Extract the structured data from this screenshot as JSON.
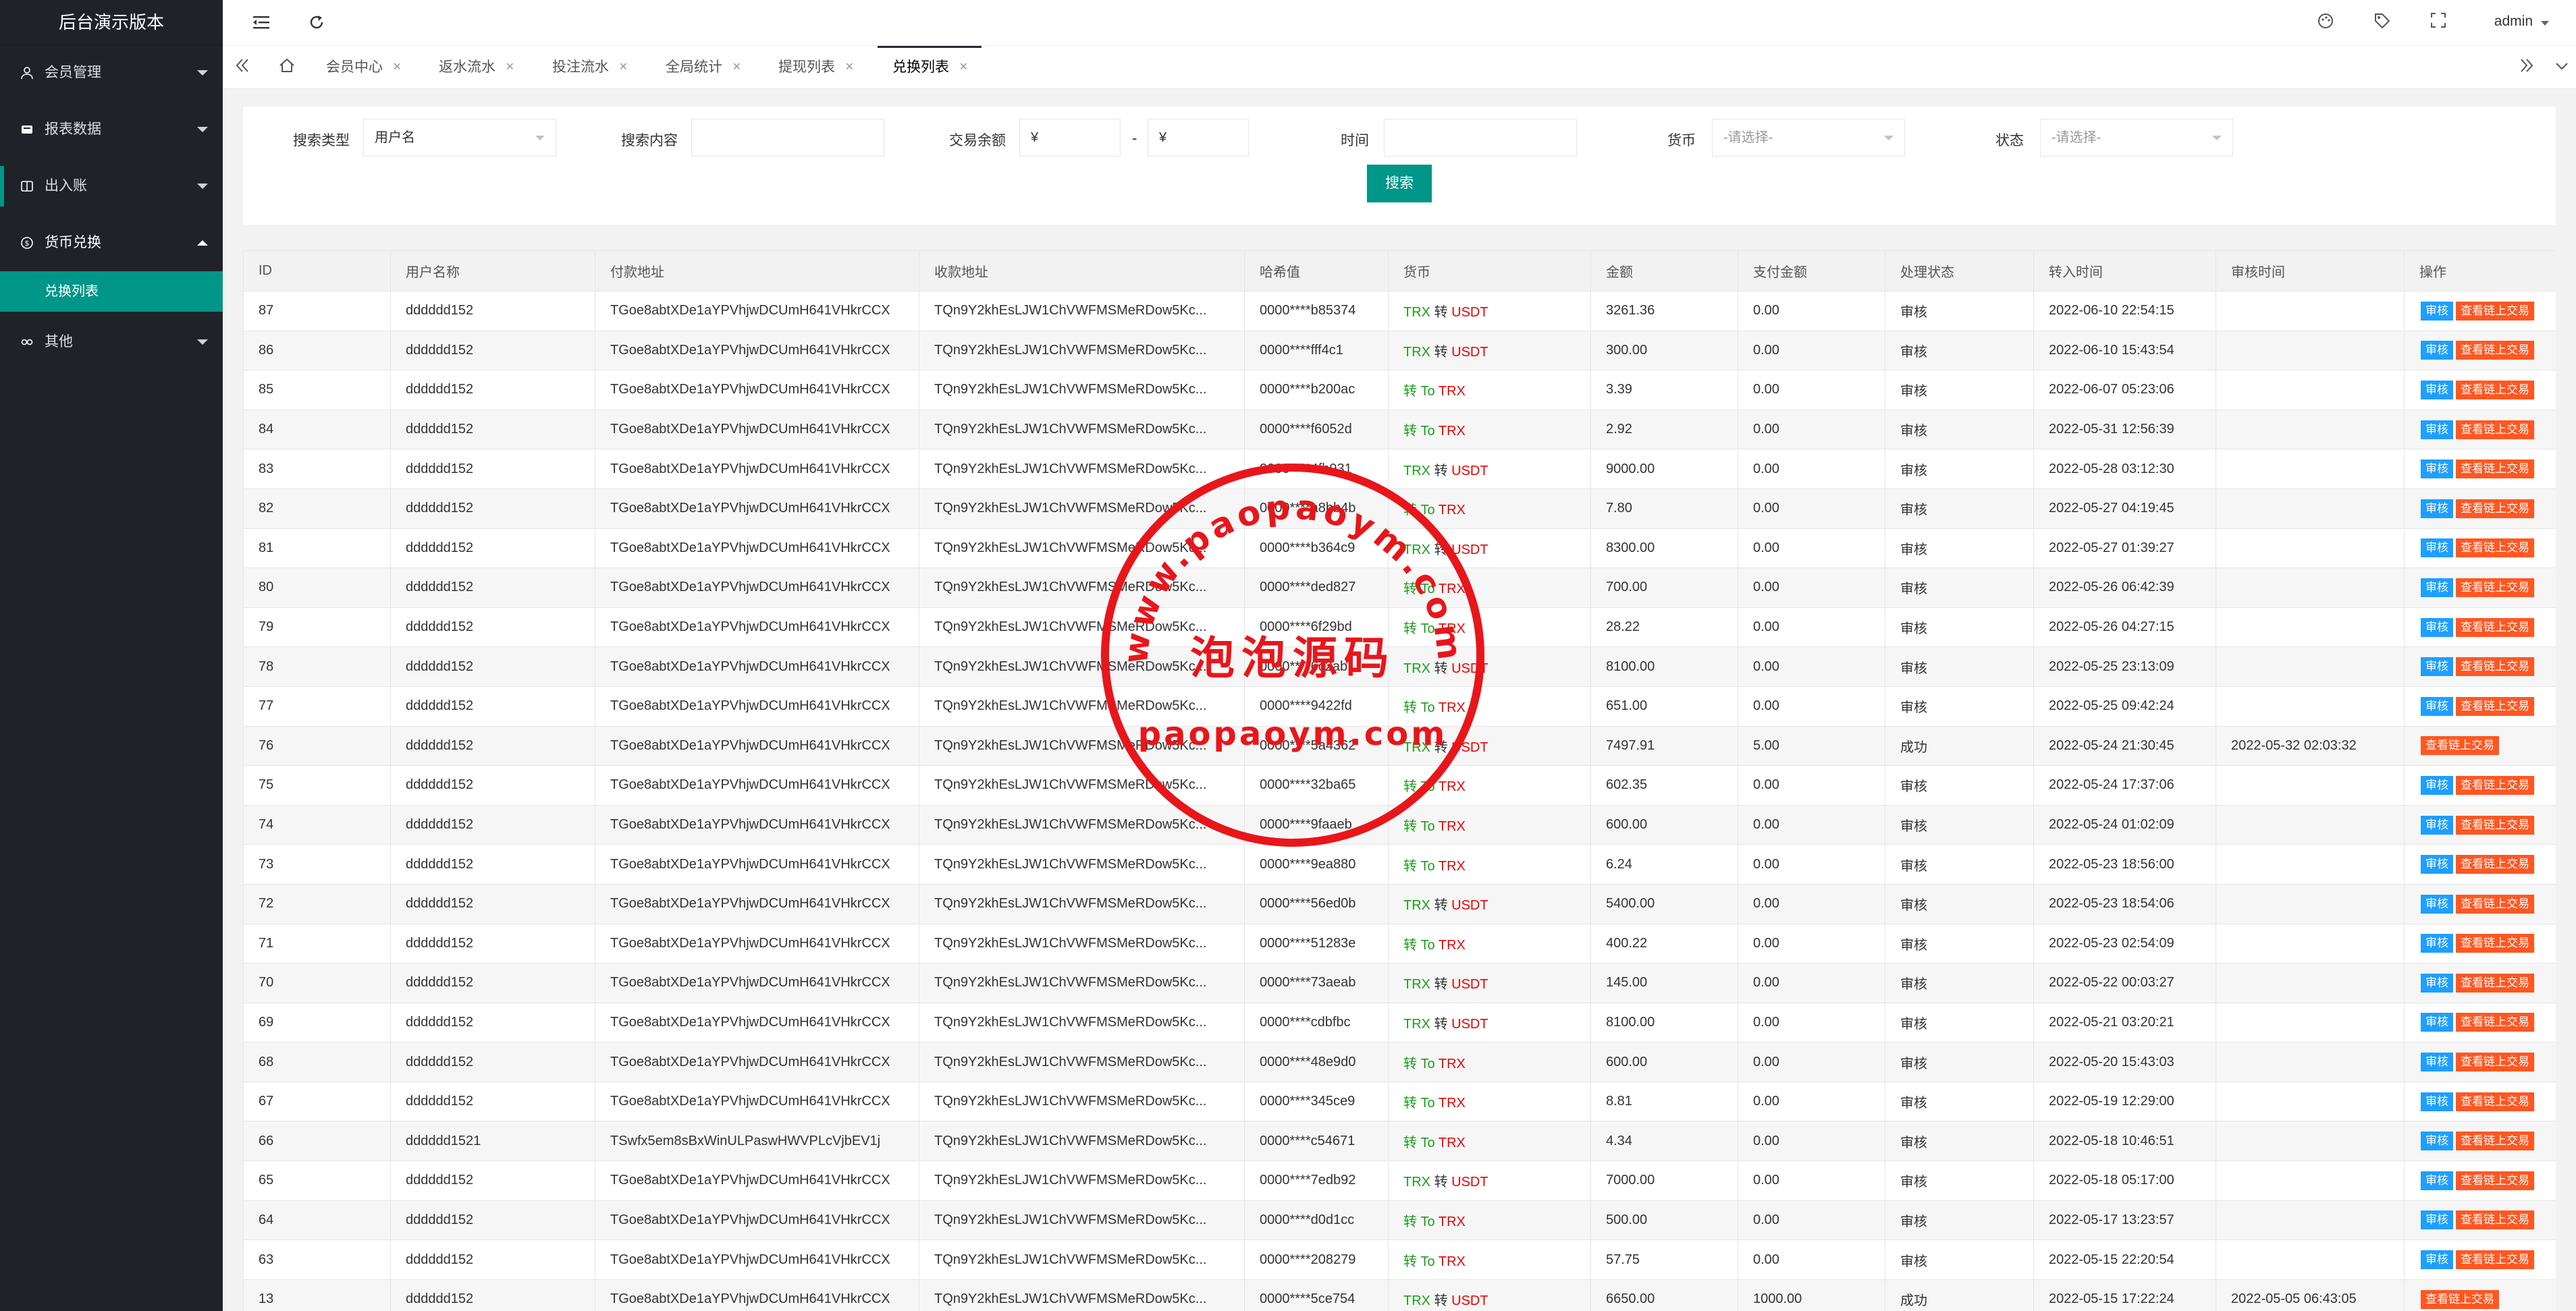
{
  "sidebar": {
    "logo": "后台演示版本",
    "items": [
      {
        "label": "会员管理",
        "icon": "user-icon"
      },
      {
        "label": "报表数据",
        "icon": "report-icon"
      },
      {
        "label": "出入账",
        "icon": "ledger-icon"
      },
      {
        "label": "货币兑换",
        "icon": "currency-icon"
      },
      {
        "label": "其他",
        "icon": "other-icon"
      }
    ],
    "subitems": [
      {
        "label": "兑换列表"
      }
    ]
  },
  "header": {
    "user": "admin"
  },
  "tabs": [
    {
      "label": "会员中心"
    },
    {
      "label": "返水流水"
    },
    {
      "label": "投注流水"
    },
    {
      "label": "全局统计"
    },
    {
      "label": "提现列表"
    },
    {
      "label": "兑换列表"
    }
  ],
  "search": {
    "type_label": "搜索类型",
    "type_value": "用户名",
    "content_label": "搜索内容",
    "amount_label": "交易余额",
    "amount_min": "¥",
    "amount_sep": "-",
    "amount_max": "¥",
    "time_label": "时间",
    "currency_label": "货币",
    "currency_placeholder": "-请选择-",
    "status_label": "状态",
    "status_placeholder": "-请选择-",
    "button": "搜索"
  },
  "table": {
    "columns": [
      "ID",
      "用户名称",
      "付款地址",
      "收款地址",
      "哈希值",
      "货币",
      "金额",
      "支付金额",
      "处理状态",
      "转入时间",
      "审核时间",
      "操作"
    ],
    "btn_audit": "审核",
    "btn_chain": "查看链上交易",
    "rows": [
      {
        "id": "87",
        "user": "dddddd152",
        "from": "TGoe8abtXDe1aYPVhjwDCUmH641VHkrCCX",
        "to": "TQn9Y2khEsLJW1ChVWFMSMeRDow5Kc...",
        "hash": "0000****b85374",
        "c1": "TRX",
        "mid": "转",
        "c2": "USDT",
        "amount": "3261.36",
        "paid": "0.00",
        "status": "审核",
        "time": "2022-06-10 22:54:15",
        "audit": "",
        "audited": false
      },
      {
        "id": "86",
        "user": "dddddd152",
        "from": "TGoe8abtXDe1aYPVhjwDCUmH641VHkrCCX",
        "to": "TQn9Y2khEsLJW1ChVWFMSMeRDow5Kc...",
        "hash": "0000****fff4c1",
        "c1": "TRX",
        "mid": "转",
        "c2": "USDT",
        "amount": "300.00",
        "paid": "0.00",
        "status": "审核",
        "time": "2022-06-10 15:43:54",
        "audit": "",
        "audited": false
      },
      {
        "id": "85",
        "user": "dddddd152",
        "from": "TGoe8abtXDe1aYPVhjwDCUmH641VHkrCCX",
        "to": "TQn9Y2khEsLJW1ChVWFMSMeRDow5Kc...",
        "hash": "0000****b200ac",
        "c1": "",
        "mid": "转 To",
        "c2": "TRX",
        "amount": "3.39",
        "paid": "0.00",
        "status": "审核",
        "time": "2022-06-07 05:23:06",
        "audit": "",
        "audited": false
      },
      {
        "id": "84",
        "user": "dddddd152",
        "from": "TGoe8abtXDe1aYPVhjwDCUmH641VHkrCCX",
        "to": "TQn9Y2khEsLJW1ChVWFMSMeRDow5Kc...",
        "hash": "0000****f6052d",
        "c1": "",
        "mid": "转 To",
        "c2": "TRX",
        "amount": "2.92",
        "paid": "0.00",
        "status": "审核",
        "time": "2022-05-31 12:56:39",
        "audit": "",
        "audited": false
      },
      {
        "id": "83",
        "user": "dddddd152",
        "from": "TGoe8abtXDe1aYPVhjwDCUmH641VHkrCCX",
        "to": "TQn9Y2khEsLJW1ChVWFMSMeRDow5Kc...",
        "hash": "0000****4fb931",
        "c1": "TRX",
        "mid": "转",
        "c2": "USDT",
        "amount": "9000.00",
        "paid": "0.00",
        "status": "审核",
        "time": "2022-05-28 03:12:30",
        "audit": "",
        "audited": false
      },
      {
        "id": "82",
        "user": "dddddd152",
        "from": "TGoe8abtXDe1aYPVhjwDCUmH641VHkrCCX",
        "to": "TQn9Y2khEsLJW1ChVWFMSMeRDow5Kc...",
        "hash": "0000****a8bb4b",
        "c1": "",
        "mid": "转 To",
        "c2": "TRX",
        "amount": "7.80",
        "paid": "0.00",
        "status": "审核",
        "time": "2022-05-27 04:19:45",
        "audit": "",
        "audited": false
      },
      {
        "id": "81",
        "user": "dddddd152",
        "from": "TGoe8abtXDe1aYPVhjwDCUmH641VHkrCCX",
        "to": "TQn9Y2khEsLJW1ChVWFMSMeRDow5Kc...",
        "hash": "0000****b364c9",
        "c1": "TRX",
        "mid": "转",
        "c2": "USDT",
        "amount": "8300.00",
        "paid": "0.00",
        "status": "审核",
        "time": "2022-05-27 01:39:27",
        "audit": "",
        "audited": false
      },
      {
        "id": "80",
        "user": "dddddd152",
        "from": "TGoe8abtXDe1aYPVhjwDCUmH641VHkrCCX",
        "to": "TQn9Y2khEsLJW1ChVWFMSMeRDow5Kc...",
        "hash": "0000****ded827",
        "c1": "",
        "mid": "转 To",
        "c2": "TRX",
        "amount": "700.00",
        "paid": "0.00",
        "status": "审核",
        "time": "2022-05-26 06:42:39",
        "audit": "",
        "audited": false
      },
      {
        "id": "79",
        "user": "dddddd152",
        "from": "TGoe8abtXDe1aYPVhjwDCUmH641VHkrCCX",
        "to": "TQn9Y2khEsLJW1ChVWFMSMeRDow5Kc...",
        "hash": "0000****6f29bd",
        "c1": "",
        "mid": "转 To",
        "c2": "TRX",
        "amount": "28.22",
        "paid": "0.00",
        "status": "审核",
        "time": "2022-05-26 04:27:15",
        "audit": "",
        "audited": false
      },
      {
        "id": "78",
        "user": "dddddd152",
        "from": "TGoe8abtXDe1aYPVhjwDCUmH641VHkrCCX",
        "to": "TQn9Y2khEsLJW1ChVWFMSMeRDow5Kc...",
        "hash": "0000****6c2ab1",
        "c1": "TRX",
        "mid": "转",
        "c2": "USDT",
        "amount": "8100.00",
        "paid": "0.00",
        "status": "审核",
        "time": "2022-05-25 23:13:09",
        "audit": "",
        "audited": false
      },
      {
        "id": "77",
        "user": "dddddd152",
        "from": "TGoe8abtXDe1aYPVhjwDCUmH641VHkrCCX",
        "to": "TQn9Y2khEsLJW1ChVWFMSMeRDow5Kc...",
        "hash": "0000****9422fd",
        "c1": "",
        "mid": "转 To",
        "c2": "TRX",
        "amount": "651.00",
        "paid": "0.00",
        "status": "审核",
        "time": "2022-05-25 09:42:24",
        "audit": "",
        "audited": false
      },
      {
        "id": "76",
        "user": "dddddd152",
        "from": "TGoe8abtXDe1aYPVhjwDCUmH641VHkrCCX",
        "to": "TQn9Y2khEsLJW1ChVWFMSMeRDow5Kc...",
        "hash": "0000****5a4362",
        "c1": "TRX",
        "mid": "转",
        "c2": "USDT",
        "amount": "7497.91",
        "paid": "5.00",
        "status": "成功",
        "time": "2022-05-24 21:30:45",
        "audit": "2022-05-32 02:03:32",
        "audited": true
      },
      {
        "id": "75",
        "user": "dddddd152",
        "from": "TGoe8abtXDe1aYPVhjwDCUmH641VHkrCCX",
        "to": "TQn9Y2khEsLJW1ChVWFMSMeRDow5Kc...",
        "hash": "0000****32ba65",
        "c1": "",
        "mid": "转 To",
        "c2": "TRX",
        "amount": "602.35",
        "paid": "0.00",
        "status": "审核",
        "time": "2022-05-24 17:37:06",
        "audit": "",
        "audited": false
      },
      {
        "id": "74",
        "user": "dddddd152",
        "from": "TGoe8abtXDe1aYPVhjwDCUmH641VHkrCCX",
        "to": "TQn9Y2khEsLJW1ChVWFMSMeRDow5Kc...",
        "hash": "0000****9faaeb",
        "c1": "",
        "mid": "转 To",
        "c2": "TRX",
        "amount": "600.00",
        "paid": "0.00",
        "status": "审核",
        "time": "2022-05-24 01:02:09",
        "audit": "",
        "audited": false
      },
      {
        "id": "73",
        "user": "dddddd152",
        "from": "TGoe8abtXDe1aYPVhjwDCUmH641VHkrCCX",
        "to": "TQn9Y2khEsLJW1ChVWFMSMeRDow5Kc...",
        "hash": "0000****9ea880",
        "c1": "",
        "mid": "转 To",
        "c2": "TRX",
        "amount": "6.24",
        "paid": "0.00",
        "status": "审核",
        "time": "2022-05-23 18:56:00",
        "audit": "",
        "audited": false
      },
      {
        "id": "72",
        "user": "dddddd152",
        "from": "TGoe8abtXDe1aYPVhjwDCUmH641VHkrCCX",
        "to": "TQn9Y2khEsLJW1ChVWFMSMeRDow5Kc...",
        "hash": "0000****56ed0b",
        "c1": "TRX",
        "mid": "转",
        "c2": "USDT",
        "amount": "5400.00",
        "paid": "0.00",
        "status": "审核",
        "time": "2022-05-23 18:54:06",
        "audit": "",
        "audited": false
      },
      {
        "id": "71",
        "user": "dddddd152",
        "from": "TGoe8abtXDe1aYPVhjwDCUmH641VHkrCCX",
        "to": "TQn9Y2khEsLJW1ChVWFMSMeRDow5Kc...",
        "hash": "0000****51283e",
        "c1": "",
        "mid": "转 To",
        "c2": "TRX",
        "amount": "400.22",
        "paid": "0.00",
        "status": "审核",
        "time": "2022-05-23 02:54:09",
        "audit": "",
        "audited": false
      },
      {
        "id": "70",
        "user": "dddddd152",
        "from": "TGoe8abtXDe1aYPVhjwDCUmH641VHkrCCX",
        "to": "TQn9Y2khEsLJW1ChVWFMSMeRDow5Kc...",
        "hash": "0000****73aeab",
        "c1": "TRX",
        "mid": "转",
        "c2": "USDT",
        "amount": "145.00",
        "paid": "0.00",
        "status": "审核",
        "time": "2022-05-22 00:03:27",
        "audit": "",
        "audited": false
      },
      {
        "id": "69",
        "user": "dddddd152",
        "from": "TGoe8abtXDe1aYPVhjwDCUmH641VHkrCCX",
        "to": "TQn9Y2khEsLJW1ChVWFMSMeRDow5Kc...",
        "hash": "0000****cdbfbc",
        "c1": "TRX",
        "mid": "转",
        "c2": "USDT",
        "amount": "8100.00",
        "paid": "0.00",
        "status": "审核",
        "time": "2022-05-21 03:20:21",
        "audit": "",
        "audited": false
      },
      {
        "id": "68",
        "user": "dddddd152",
        "from": "TGoe8abtXDe1aYPVhjwDCUmH641VHkrCCX",
        "to": "TQn9Y2khEsLJW1ChVWFMSMeRDow5Kc...",
        "hash": "0000****48e9d0",
        "c1": "",
        "mid": "转 To",
        "c2": "TRX",
        "amount": "600.00",
        "paid": "0.00",
        "status": "审核",
        "time": "2022-05-20 15:43:03",
        "audit": "",
        "audited": false
      },
      {
        "id": "67",
        "user": "dddddd152",
        "from": "TGoe8abtXDe1aYPVhjwDCUmH641VHkrCCX",
        "to": "TQn9Y2khEsLJW1ChVWFMSMeRDow5Kc...",
        "hash": "0000****345ce9",
        "c1": "",
        "mid": "转 To",
        "c2": "TRX",
        "amount": "8.81",
        "paid": "0.00",
        "status": "审核",
        "time": "2022-05-19 12:29:00",
        "audit": "",
        "audited": false
      },
      {
        "id": "66",
        "user": "dddddd1521",
        "from": "TSwfx5em8sBxWinULPaswHWVPLcVjbEV1j",
        "to": "TQn9Y2khEsLJW1ChVWFMSMeRDow5Kc...",
        "hash": "0000****c54671",
        "c1": "",
        "mid": "转 To",
        "c2": "TRX",
        "amount": "4.34",
        "paid": "0.00",
        "status": "审核",
        "time": "2022-05-18 10:46:51",
        "audit": "",
        "audited": false
      },
      {
        "id": "65",
        "user": "dddddd152",
        "from": "TGoe8abtXDe1aYPVhjwDCUmH641VHkrCCX",
        "to": "TQn9Y2khEsLJW1ChVWFMSMeRDow5Kc...",
        "hash": "0000****7edb92",
        "c1": "TRX",
        "mid": "转",
        "c2": "USDT",
        "amount": "7000.00",
        "paid": "0.00",
        "status": "审核",
        "time": "2022-05-18 05:17:00",
        "audit": "",
        "audited": false
      },
      {
        "id": "64",
        "user": "dddddd152",
        "from": "TGoe8abtXDe1aYPVhjwDCUmH641VHkrCCX",
        "to": "TQn9Y2khEsLJW1ChVWFMSMeRDow5Kc...",
        "hash": "0000****d0d1cc",
        "c1": "",
        "mid": "转 To",
        "c2": "TRX",
        "amount": "500.00",
        "paid": "0.00",
        "status": "审核",
        "time": "2022-05-17 13:23:57",
        "audit": "",
        "audited": false
      },
      {
        "id": "63",
        "user": "dddddd152",
        "from": "TGoe8abtXDe1aYPVhjwDCUmH641VHkrCCX",
        "to": "TQn9Y2khEsLJW1ChVWFMSMeRDow5Kc...",
        "hash": "0000****208279",
        "c1": "",
        "mid": "转 To",
        "c2": "TRX",
        "amount": "57.75",
        "paid": "0.00",
        "status": "审核",
        "time": "2022-05-15 22:20:54",
        "audit": "",
        "audited": false
      },
      {
        "id": "13",
        "user": "dddddd152",
        "from": "TGoe8abtXDe1aYPVhjwDCUmH641VHkrCCX",
        "to": "TQn9Y2khEsLJW1ChVWFMSMeRDow5Kc...",
        "hash": "0000****5ce754",
        "c1": "TRX",
        "mid": "转",
        "c2": "USDT",
        "amount": "6650.00",
        "paid": "1000.00",
        "status": "成功",
        "time": "2022-05-15 17:22:24",
        "audit": "2022-05-05 06:43:05",
        "audited": true
      }
    ]
  },
  "watermark": {
    "url_top": "www.paopaoym.com",
    "name": "泡泡源码",
    "url_bottom": "paopaoym.com",
    "color": "#e8161b"
  }
}
